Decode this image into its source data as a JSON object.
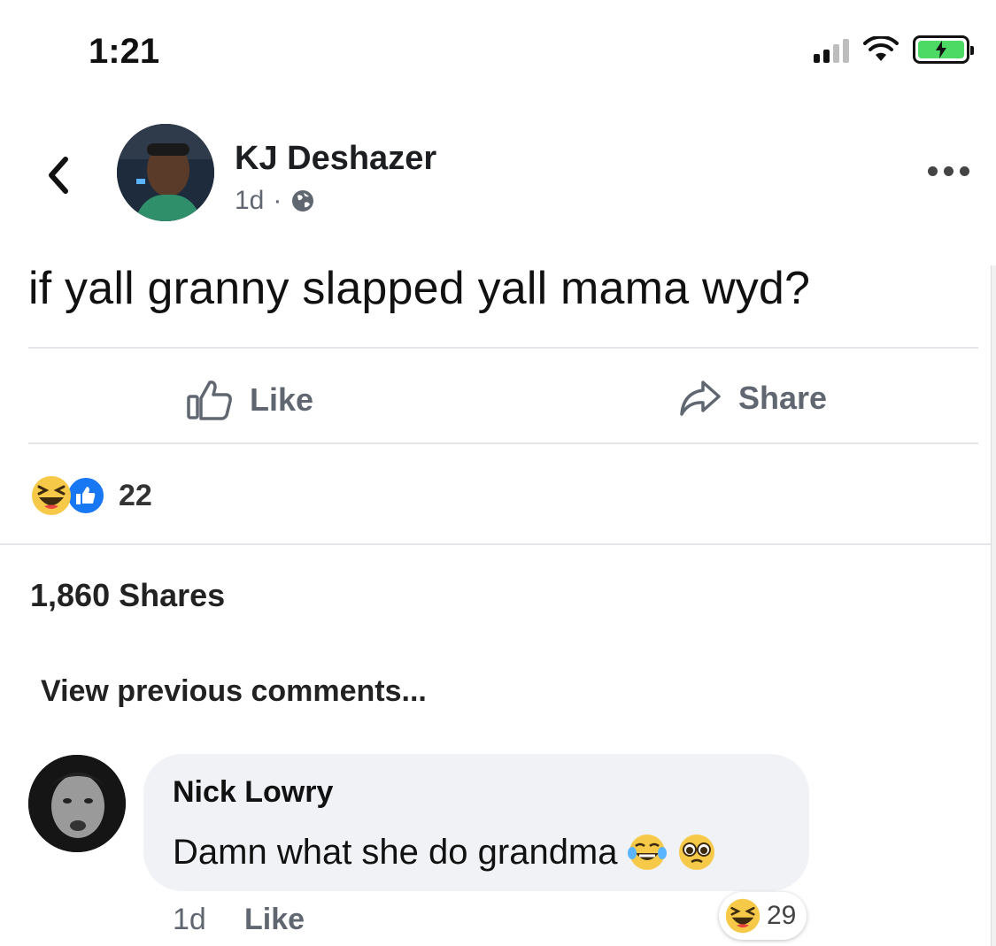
{
  "status_bar": {
    "time": "1:21"
  },
  "post": {
    "author": "KJ Deshazer",
    "age": "1d",
    "separator": "·",
    "privacy_icon": "globe-icon",
    "text": "if yall granny slapped yall mama wyd?",
    "actions": {
      "like_label": "Like",
      "share_label": "Share"
    },
    "reactions": {
      "types": [
        "haha",
        "like"
      ],
      "count": "22"
    },
    "shares_label": "1,860 Shares"
  },
  "comments": {
    "view_previous_label": "View previous comments...",
    "items": [
      {
        "author": "Nick Lowry",
        "text": "Damn what she do grandma",
        "emojis": [
          "tears-of-joy-emoji",
          "pleading-face-emoji"
        ],
        "age": "1d",
        "like_label": "Like",
        "reaction_type": "haha",
        "reaction_count": "29"
      }
    ]
  },
  "colors": {
    "like_blue": "#1877f2",
    "emoji_yellow": "#f7c948",
    "muted_text": "#606770",
    "bubble_bg": "#f0f2f5"
  }
}
